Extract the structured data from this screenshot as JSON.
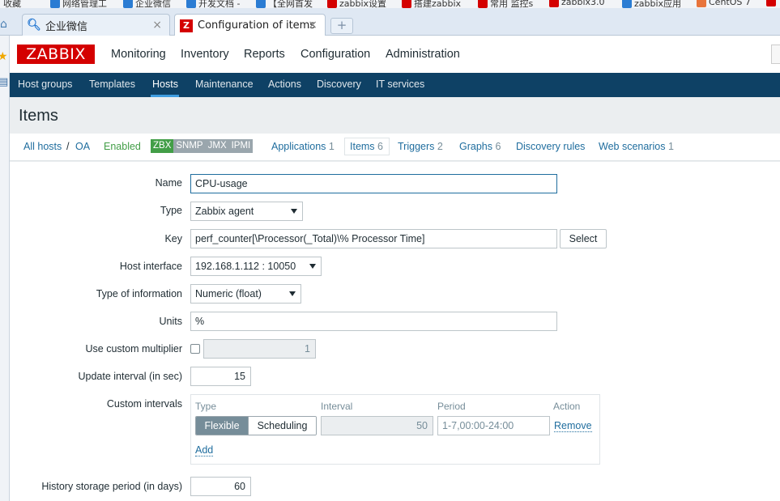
{
  "bookmarks": [
    "收藏",
    "网络管理工",
    "企业微信",
    "开发文档 -",
    "【全网首发",
    "zabbix设置",
    "搭建zabbix",
    "常用 监控s",
    "zabbix3.0",
    "zabbix应用",
    "CentOS 7"
  ],
  "browser_tabs": [
    {
      "title": "企业微信",
      "active": false
    },
    {
      "title": "Configuration of items",
      "active": true
    }
  ],
  "app": {
    "logo": "ZABBIX",
    "top_nav": [
      "Monitoring",
      "Inventory",
      "Reports",
      "Configuration",
      "Administration"
    ],
    "sub_nav": [
      "Host groups",
      "Templates",
      "Hosts",
      "Maintenance",
      "Actions",
      "Discovery",
      "IT services"
    ],
    "page_title": "Items"
  },
  "host_nav": {
    "all_hosts": "All hosts",
    "separator": "/",
    "host": "OA",
    "status": "Enabled",
    "badges": [
      "ZBX",
      "SNMP",
      "JMX",
      "IPMI"
    ],
    "applications": {
      "label": "Applications",
      "count": "1"
    },
    "items": {
      "label": "Items",
      "count": "6"
    },
    "triggers": {
      "label": "Triggers",
      "count": "2"
    },
    "graphs": {
      "label": "Graphs",
      "count": "6"
    },
    "discovery": {
      "label": "Discovery rules"
    },
    "web": {
      "label": "Web scenarios",
      "count": "1"
    }
  },
  "form": {
    "name": {
      "label": "Name",
      "value": "CPU-usage"
    },
    "type": {
      "label": "Type",
      "value": "Zabbix agent"
    },
    "key": {
      "label": "Key",
      "value": "perf_counter[\\Processor(_Total)\\% Processor Time]",
      "button": "Select"
    },
    "host_interface": {
      "label": "Host interface",
      "value": "192.168.1.112 : 10050"
    },
    "type_of_info": {
      "label": "Type of information",
      "value": "Numeric (float)"
    },
    "units": {
      "label": "Units",
      "value": "%"
    },
    "multiplier": {
      "label": "Use custom multiplier",
      "value": "1"
    },
    "update_interval": {
      "label": "Update interval (in sec)",
      "value": "15"
    },
    "custom_intervals": {
      "label": "Custom intervals",
      "headers": {
        "type": "Type",
        "interval": "Interval",
        "period": "Period",
        "action": "Action"
      },
      "row": {
        "flexible": "Flexible",
        "scheduling": "Scheduling",
        "interval": "50",
        "period": "1-7,00:00-24:00",
        "remove": "Remove"
      },
      "add": "Add"
    },
    "history": {
      "label": "History storage period (in days)",
      "value": "60"
    }
  }
}
